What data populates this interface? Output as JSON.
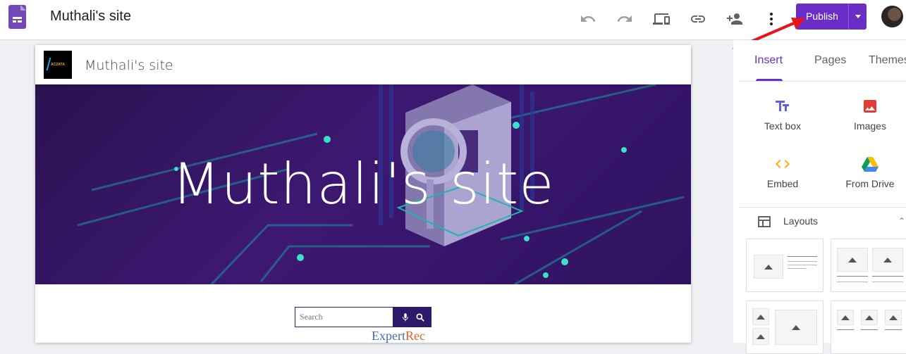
{
  "app": {
    "site_title": "Muthali's site"
  },
  "toolbar": {
    "undo_icon": "undo-icon",
    "redo_icon": "redo-icon",
    "preview_icon": "devices-icon",
    "link_icon": "link-icon",
    "share_icon": "person-add-icon",
    "more_icon": "more-vert-icon",
    "publish_label": "Publish",
    "accent": "#6a2ec6"
  },
  "site": {
    "header_name": "Muthali's site",
    "logo_text": "ACZATA",
    "banner_title": "Muthali's site",
    "search_placeholder": "Search",
    "brand_part1": "Expert",
    "brand_part2": "Rec"
  },
  "panel": {
    "tabs": [
      {
        "label": "Insert",
        "active": true
      },
      {
        "label": "Pages",
        "active": false
      },
      {
        "label": "Themes",
        "active": false
      }
    ],
    "tools": [
      {
        "label": "Text box",
        "icon": "text-box-icon"
      },
      {
        "label": "Images",
        "icon": "image-icon"
      },
      {
        "label": "Embed",
        "icon": "embed-icon"
      },
      {
        "label": "From Drive",
        "icon": "drive-icon"
      }
    ],
    "layouts_label": "Layouts"
  }
}
